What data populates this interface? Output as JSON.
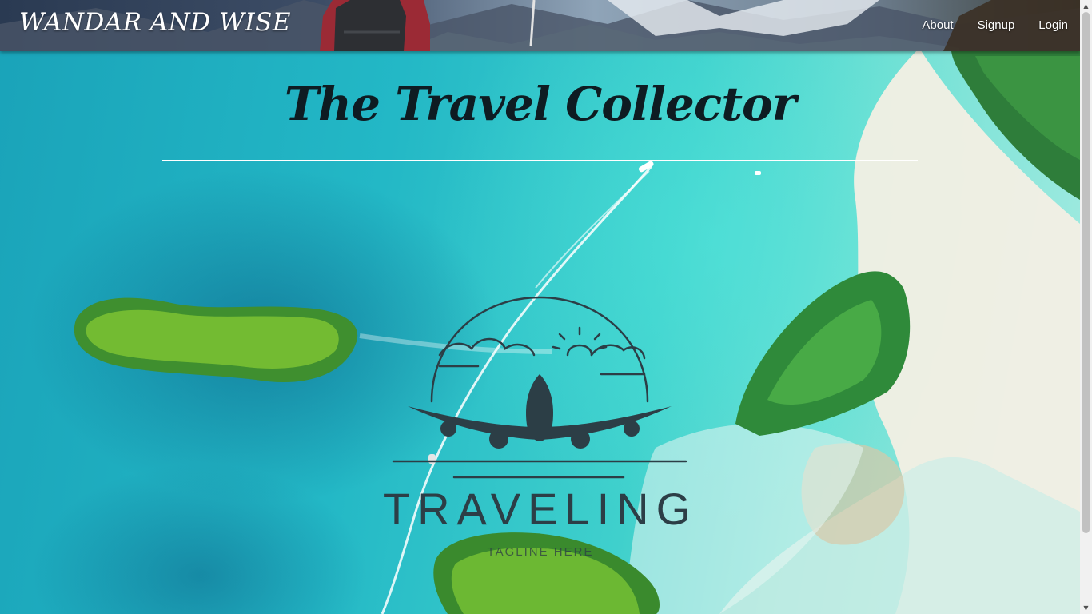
{
  "navbar": {
    "brand": "WANDAR AND WISE",
    "links": [
      {
        "label": "About"
      },
      {
        "label": "Signup"
      },
      {
        "label": "Login"
      }
    ]
  },
  "hero": {
    "title": "The Travel Collector"
  },
  "logo": {
    "word": "TRAVELING",
    "tagline": "TAGLINE HERE",
    "icon": "airplane-icon"
  },
  "colors": {
    "title_text": "#0e1c22",
    "logo_ink": "#2c3e46",
    "divider": "#ffffff",
    "nav_text": "#ffffff"
  }
}
